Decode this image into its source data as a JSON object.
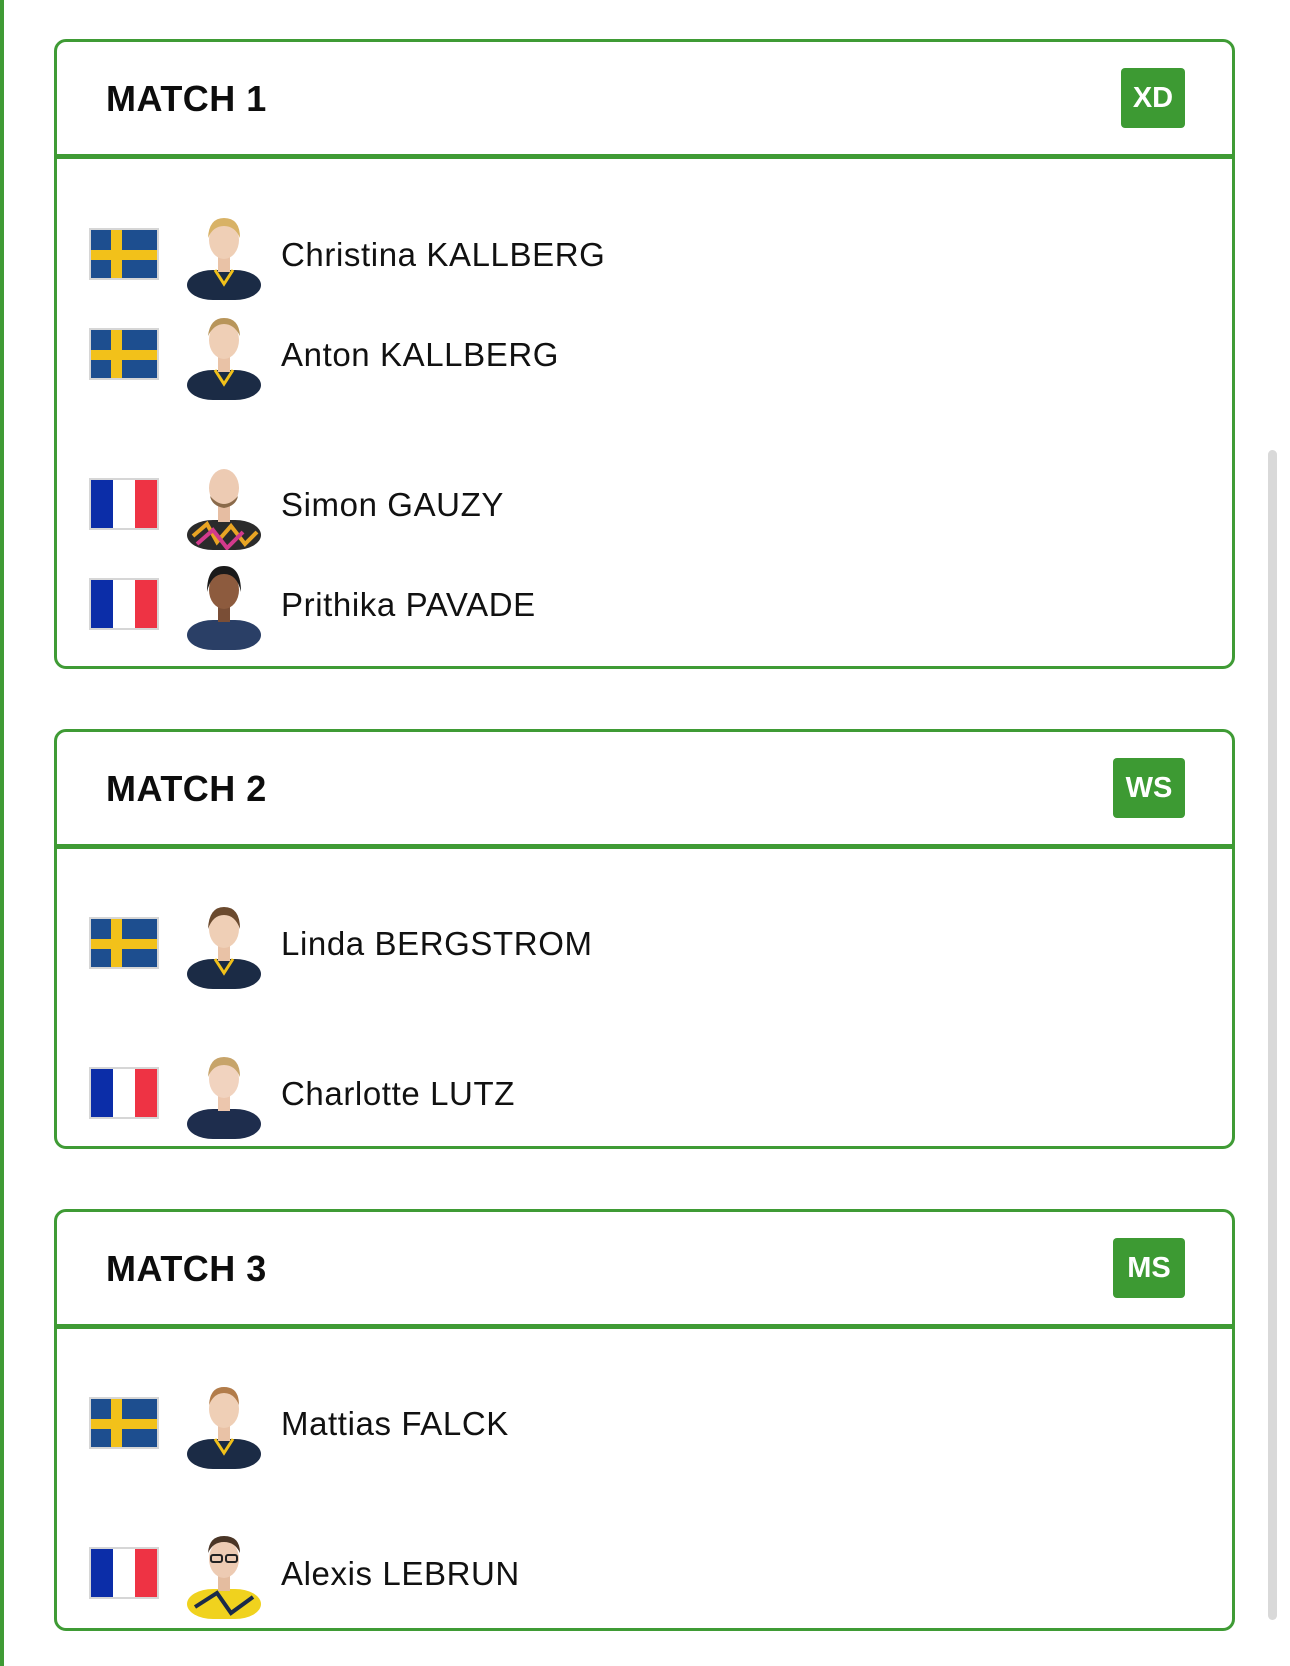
{
  "colors": {
    "accent_green": "#3f9b35",
    "sweden_blue": "#1d4e8f",
    "sweden_yellow": "#f2c11a",
    "france_blue": "#0b2da8",
    "france_red": "#ee3344"
  },
  "matches": [
    {
      "title": "MATCH 1",
      "badge": "XD",
      "players": [
        {
          "name": "Christina KALLBERG",
          "flag": "sweden-flag-icon"
        },
        {
          "name": "Anton KALLBERG",
          "flag": "sweden-flag-icon"
        },
        {
          "name": "Simon GAUZY",
          "flag": "france-flag-icon"
        },
        {
          "name": "Prithika PAVADE",
          "flag": "france-flag-icon"
        }
      ]
    },
    {
      "title": "MATCH 2",
      "badge": "WS",
      "players": [
        {
          "name": "Linda BERGSTROM",
          "flag": "sweden-flag-icon"
        },
        {
          "name": "Charlotte LUTZ",
          "flag": "france-flag-icon"
        }
      ]
    },
    {
      "title": "MATCH 3",
      "badge": "MS",
      "players": [
        {
          "name": "Mattias FALCK",
          "flag": "sweden-flag-icon"
        },
        {
          "name": "Alexis LEBRUN",
          "flag": "france-flag-icon"
        }
      ]
    }
  ]
}
